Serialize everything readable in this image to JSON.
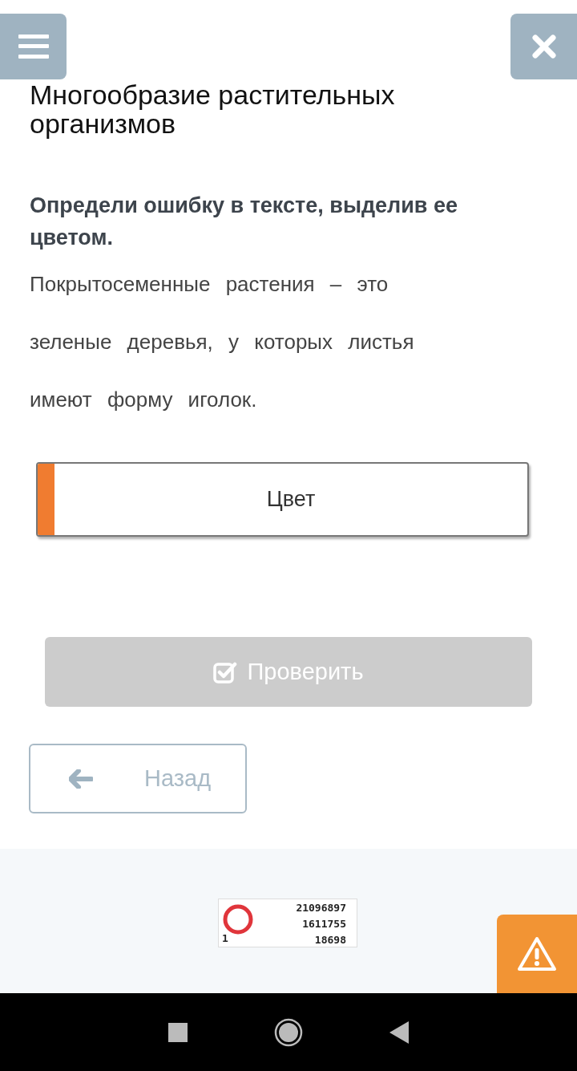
{
  "title": "Многообразие растительных организмов",
  "instruction": "Определи ошибку в тексте, выделив ее цветом.",
  "task_text": "Покрытосеменные растения – это зеленые деревья, у которых листья имеют форму иголок.",
  "color_picker": {
    "label": "Цвет",
    "color": "#f07c30"
  },
  "check_button": {
    "label": "Проверить",
    "disabled": true
  },
  "back_button": {
    "label": "Назад"
  },
  "counter": {
    "lines": [
      "21096897",
      "1611755",
      "18698"
    ],
    "corner": "1"
  }
}
